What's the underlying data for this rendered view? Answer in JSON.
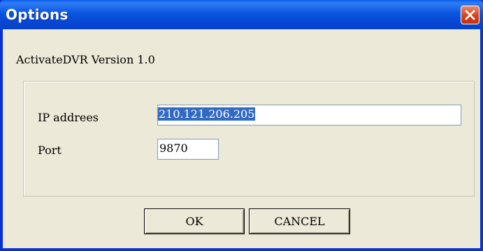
{
  "window": {
    "title": "Options"
  },
  "dialog": {
    "version_text": "ActivateDVR Version 1.0",
    "ip_label": "IP addrees",
    "ip_value": "210.121.206.205",
    "port_label": "Port",
    "port_value": "9870",
    "ok_label": "OK",
    "cancel_label": "CANCEL"
  },
  "icons": {
    "close": "close-icon"
  },
  "colors": {
    "titlebar": "#0054e3",
    "close_button": "#d5421d",
    "dialog_background": "#ece9d8",
    "selection": "#316ac5"
  }
}
